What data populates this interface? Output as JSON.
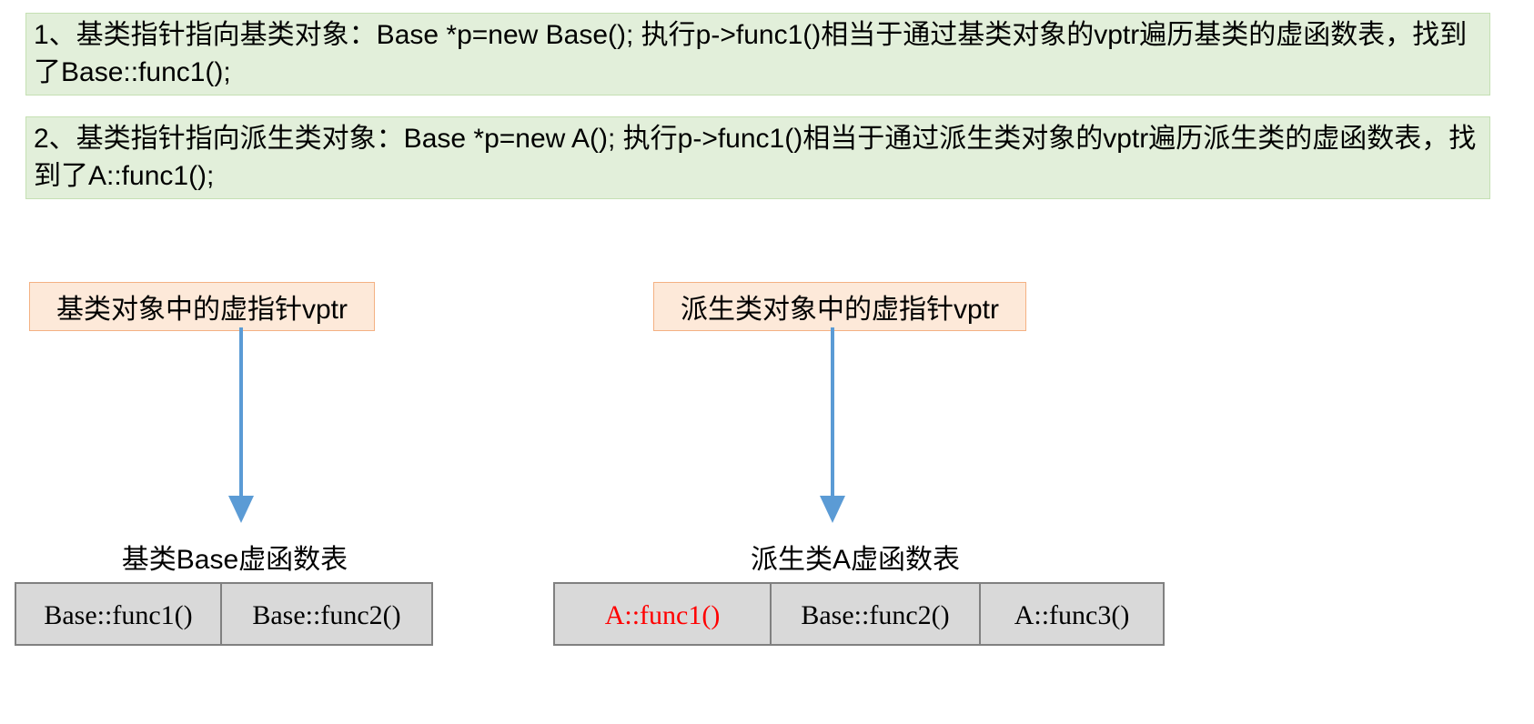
{
  "block1": "1、基类指针指向基类对象：Base *p=new Base(); 执行p->func1()相当于通过基类对象的vptr遍历基类的虚函数表，找到了Base::func1();",
  "block2": "2、基类指针指向派生类对象：Base *p=new A(); 执行p->func1()相当于通过派生类对象的vptr遍历派生类的虚函数表，找到了A::func1();",
  "base": {
    "vptr_label": "基类对象中的虚指针vptr",
    "vtable_title": "基类Base虚函数表",
    "cells": [
      "Base::func1()",
      "Base::func2()"
    ],
    "highlighted": []
  },
  "derived": {
    "vptr_label": "派生类对象中的虚指针vptr",
    "vtable_title": "派生类A虚函数表",
    "cells": [
      "A::func1()",
      "Base::func2()",
      "A::func3()"
    ],
    "highlighted": [
      0
    ]
  },
  "colors": {
    "block_bg": "#e2efda",
    "label_bg": "#fde9d9",
    "cell_bg": "#d9d9d9",
    "arrow": "#5b9bd5",
    "highlight": "#ff0000"
  }
}
